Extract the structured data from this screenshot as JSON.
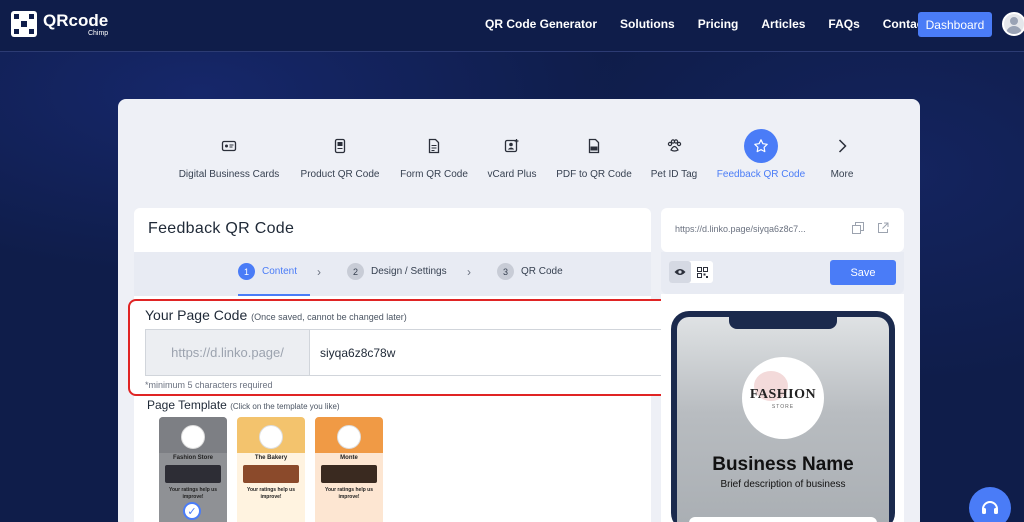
{
  "brand": {
    "name": "QRcode",
    "sub": "Chimp"
  },
  "nav": {
    "links": [
      "QR Code Generator",
      "Solutions",
      "Pricing",
      "Articles",
      "FAQs",
      "Contact Us"
    ],
    "dashboard": "Dashboard"
  },
  "categories": [
    {
      "label": "Digital Business Cards",
      "icon": "business-card-icon"
    },
    {
      "label": "Product QR Code",
      "icon": "product-icon"
    },
    {
      "label": "Form QR Code",
      "icon": "form-icon"
    },
    {
      "label": "vCard Plus",
      "icon": "vcard-icon"
    },
    {
      "label": "PDF to QR Code",
      "icon": "pdf-icon"
    },
    {
      "label": "Pet ID Tag",
      "icon": "paw-icon"
    },
    {
      "label": "Feedback QR Code",
      "icon": "star-icon",
      "active": true
    },
    {
      "label": "More",
      "icon": "chevron-right-icon"
    }
  ],
  "panel": {
    "title": "Feedback QR Code"
  },
  "steps": [
    {
      "num": "1",
      "label": "Content",
      "active": true
    },
    {
      "num": "2",
      "label": "Design / Settings"
    },
    {
      "num": "3",
      "label": "QR Code"
    }
  ],
  "page_code": {
    "title": "Your Page Code",
    "hint": "(Once saved, cannot be changed later)",
    "prefix": "https://d.linko.page/",
    "value": "siyqa6z8c78w",
    "note": "*minimum 5 characters required"
  },
  "template": {
    "title": "Page Template",
    "hint": "(Click on the template you like)",
    "items": [
      {
        "name": "Fashion Store",
        "rating_text": "Your ratings help us improve!",
        "color": "#9a9a9a"
      },
      {
        "name": "The Bakery",
        "rating_text": "Your ratings help us improve!",
        "color": "#f3c36d"
      },
      {
        "name": "Monte",
        "rating_text": "Your ratings help us improve!",
        "color": "#f09a45"
      }
    ]
  },
  "preview": {
    "url": "https://d.linko.page/siyqa6z8c7...",
    "save": "Save",
    "brand_name": "FASHION",
    "brand_sub": "STORE",
    "business_name": "Business Name",
    "business_desc": "Brief description of business"
  },
  "colors": {
    "accent": "#4a7cf7",
    "nav_bg": "#0f1d4a",
    "highlight": "#e02424"
  }
}
